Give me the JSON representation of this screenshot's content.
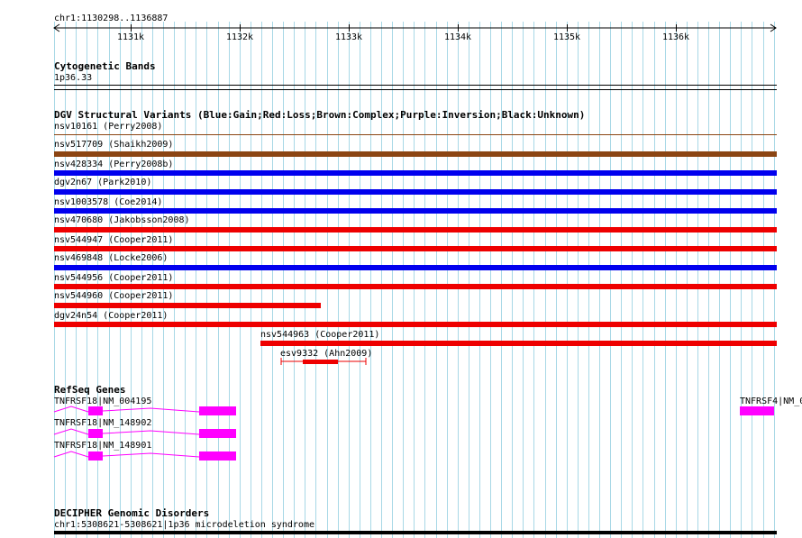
{
  "ruler": {
    "region": "chr1:1130298..1136887",
    "ticks": [
      "1131k",
      "1132k",
      "1133k",
      "1134k",
      "1135k",
      "1136k"
    ]
  },
  "cytobands": {
    "title": "Cytogenetic Bands",
    "band": "1p36.33"
  },
  "dgv": {
    "title": "DGV Structural Variants (Blue:Gain;Red:Loss;Brown:Complex;Purple:Inversion;Black:Unknown)",
    "colors": {
      "gain": "#0000ee",
      "loss": "#ee0000",
      "complex": "#8b4513"
    },
    "items": [
      {
        "label": "nsv10161 (Perry2008)",
        "type": "complex"
      },
      {
        "label": "nsv517709 (Shaikh2009)",
        "type": "complex"
      },
      {
        "label": "nsv428334 (Perry2008b)",
        "type": "gain"
      },
      {
        "label": "dgv2n67 (Park2010)",
        "type": "gain"
      },
      {
        "label": "nsv1003578 (Coe2014)",
        "type": "gain"
      },
      {
        "label": "nsv470680 (Jakobsson2008)",
        "type": "loss"
      },
      {
        "label": "nsv544947 (Cooper2011)",
        "type": "loss"
      },
      {
        "label": "nsv469848 (Locke2006)",
        "type": "gain"
      },
      {
        "label": "nsv544956 (Cooper2011)",
        "type": "loss"
      },
      {
        "label": "nsv544960 (Cooper2011)",
        "type": "loss"
      },
      {
        "label": "dgv24n54 (Cooper2011)",
        "type": "loss"
      },
      {
        "label": "nsv544963 (Cooper2011)",
        "type": "loss"
      },
      {
        "label": "esv9332 (Ahn2009)",
        "type": "loss"
      }
    ]
  },
  "refseq": {
    "title": "RefSeq Genes",
    "color": "#ff00ff",
    "genes": [
      {
        "label": "TNFRSF18|NM_004195"
      },
      {
        "label": "TNFRSF18|NM_148902"
      },
      {
        "label": "TNFRSF18|NM_148901"
      },
      {
        "label": "TNFRSF4|NM_0"
      }
    ]
  },
  "decipher": {
    "title": "DECIPHER Genomic Disorders",
    "item": "chr1:5308621-5308621|1p36 microdeletion syndrome"
  }
}
